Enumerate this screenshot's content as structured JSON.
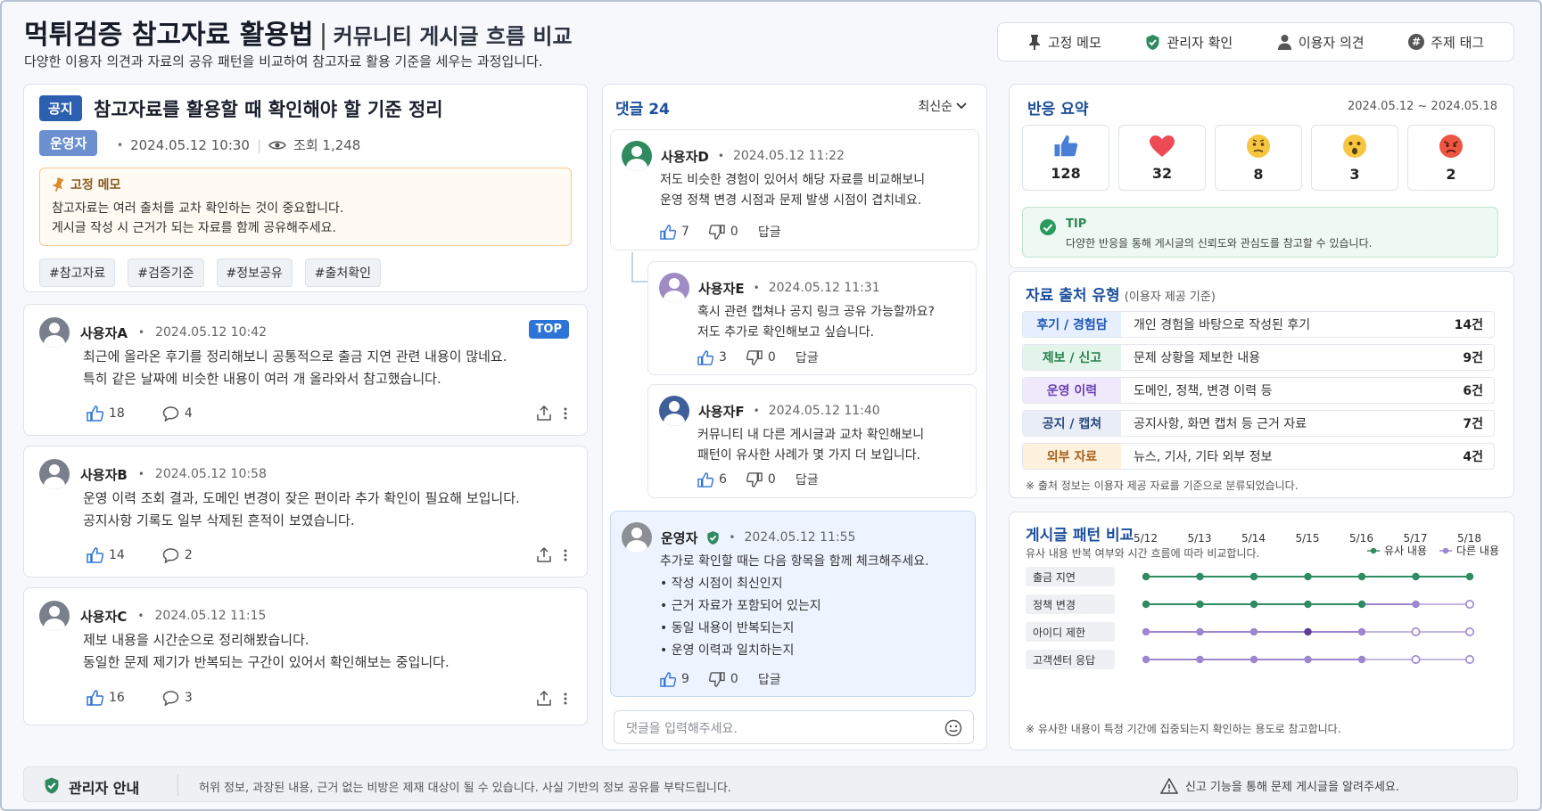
{
  "header": {
    "title": "먹튀검증 참고자료 활용법",
    "title_sep": "|",
    "subtitle": "커뮤니티 게시글 흐름 비교",
    "description": "다양한 이용자 의견과 자료의 공유 패턴을 비교하여 참고자료 활용 기준을 세우는 과정입니다.",
    "filters": [
      {
        "label": "고정 메모",
        "icon": "pin-icon"
      },
      {
        "label": "관리자 확인",
        "icon": "shield-icon"
      },
      {
        "label": "이용자 의견",
        "icon": "user-icon"
      },
      {
        "label": "주제 태그",
        "icon": "hash-icon"
      }
    ]
  },
  "notice": {
    "badge": "공지",
    "title": "참고자료를 활용할 때 확인해야 할 기준 정리",
    "author_badge": "운영자",
    "date": "2024.05.12 10:30",
    "views": "조회 1,248",
    "pin_title": "고정 메모",
    "pin_lines": [
      "참고자료는 여러 출처를 교차 확인하는 것이 중요합니다.",
      "게시글 작성 시 근거가 되는 자료를 함께 공유해주세요."
    ],
    "tags": [
      "#참고자료",
      "#검증기준",
      "#정보공유",
      "#출처확인"
    ]
  },
  "posts": [
    {
      "user": "사용자A",
      "time": "2024.05.12 10:42",
      "badge": "TOP",
      "lines": [
        "최근에 올라온 후기를 정리해보니 공통적으로 출금 지연 관련 내용이 많네요.",
        "특히 같은 날짜에 비슷한 내용이 여러 개 올라와서 참고했습니다."
      ],
      "likes": "18",
      "comments": "4"
    },
    {
      "user": "사용자B",
      "time": "2024.05.12 10:58",
      "lines": [
        "운영 이력 조회 결과, 도메인 변경이 잦은 편이라 추가 확인이 필요해 보입니다.",
        "공지사항 기록도 일부 삭제된 흔적이 보였습니다."
      ],
      "likes": "14",
      "comments": "2"
    },
    {
      "user": "사용자C",
      "time": "2024.05.12 11:15",
      "lines": [
        "제보 내용을 시간순으로 정리해봤습니다.",
        "동일한 문제 제기가 반복되는 구간이 있어서 확인해보는 중입니다."
      ],
      "likes": "16",
      "comments": "3"
    }
  ],
  "comments": {
    "title": "댓글 24",
    "sort": "최신순",
    "reply_label": "답글",
    "items": [
      {
        "user": "사용자D",
        "time": "2024.05.12 11:22",
        "lines": [
          "저도 비슷한 경험이 있어서 해당 자료를 비교해보니",
          "운영 정책 변경 시점과 문제 발생 시점이 겹치네요."
        ],
        "likes": "7",
        "dislikes": "0"
      },
      {
        "user": "사용자E",
        "time": "2024.05.12 11:31",
        "lines": [
          "혹시 관련 캡쳐나 공지 링크 공유 가능할까요?",
          "저도 추가로 확인해보고 싶습니다."
        ],
        "likes": "3",
        "dislikes": "0"
      },
      {
        "user": "사용자F",
        "time": "2024.05.12 11:40",
        "lines": [
          "커뮤니티 내 다른 게시글과 교차 확인해보니",
          "패턴이 유사한 사례가 몇 가지 더 보입니다."
        ],
        "likes": "6",
        "dislikes": "0"
      },
      {
        "user": "운영자",
        "time": "2024.05.12 11:55",
        "intro": "추가로 확인할 때는 다음 항목을 함께 체크해주세요.",
        "bullets": [
          "작성 시점이 최신인지",
          "근거 자료가 포함되어 있는지",
          "동일 내용이 반복되는지",
          "운영 이력과 일치하는지"
        ],
        "likes": "9",
        "dislikes": "0"
      }
    ],
    "input_placeholder": "댓글을 입력해주세요."
  },
  "reactions": {
    "title": "반응 요약",
    "range": "2024.05.12 ~ 2024.05.18",
    "items": [
      {
        "icon": "thumbs-up-icon",
        "count": "128"
      },
      {
        "icon": "heart-icon",
        "count": "32"
      },
      {
        "icon": "confused-face-icon",
        "count": "8"
      },
      {
        "icon": "surprised-face-icon",
        "count": "3"
      },
      {
        "icon": "angry-face-icon",
        "count": "2"
      }
    ],
    "tip_title": "TIP",
    "tip_text": "다양한 반응을 통해 게시글의 신뢰도와 관심도를 참고할 수 있습니다."
  },
  "sources": {
    "title": "자료 출처 유형",
    "subtitle": "(이용자 제공 기준)",
    "rows": [
      {
        "tag": "후기 / 경험담",
        "desc": "개인 경험을 바탕으로 작성된 후기",
        "count": "14건",
        "bg": "#e6efff",
        "fg": "#1e55b3"
      },
      {
        "tag": "제보 / 신고",
        "desc": "문제 상황을 제보한 내용",
        "count": "9건",
        "bg": "#e3f5ea",
        "fg": "#27824f"
      },
      {
        "tag": "운영 이력",
        "desc": "도메인, 정책, 변경 이력 등",
        "count": "6건",
        "bg": "#f0e9fb",
        "fg": "#6b3fb5"
      },
      {
        "tag": "공지 / 캡쳐",
        "desc": "공지사항, 화면 캡처 등 근거 자료",
        "count": "7건",
        "bg": "#e8edf7",
        "fg": "#2d4a80"
      },
      {
        "tag": "외부 자료",
        "desc": "뉴스, 기사, 기타 외부 정보",
        "count": "4건",
        "bg": "#fdf0dc",
        "fg": "#a8611a"
      }
    ],
    "note": "※ 출처 정보는 이용자 제공 자료를 기준으로 분류되었습니다."
  },
  "pattern": {
    "title": "게시글 패턴 비교",
    "subtitle": "유사 내용 반복 여부와 시간 흐름에 따라 비교합니다.",
    "legend": [
      {
        "label": "유사 내용",
        "color": "#2e8b62"
      },
      {
        "label": "다른 내용",
        "color": "#9b86cf"
      }
    ],
    "dates": [
      "5/12",
      "5/13",
      "5/14",
      "5/15",
      "5/16",
      "5/17",
      "5/18"
    ],
    "rows": [
      {
        "label": "출금 지연",
        "marks": [
          "similar",
          "similar",
          "similar",
          "similar",
          "similar",
          "similar",
          "similar"
        ]
      },
      {
        "label": "정책 변경",
        "marks": [
          "similar",
          "similar",
          "similar",
          "similar",
          "similar",
          "different",
          "different-open"
        ]
      },
      {
        "label": "아이디 제한",
        "marks": [
          "different",
          "different",
          "different",
          "different-dark",
          "different",
          "different-open",
          "different-open"
        ]
      },
      {
        "label": "고객센터 응답",
        "marks": [
          "different",
          "different",
          "different",
          "different",
          "different",
          "different-open",
          "different-open"
        ]
      }
    ],
    "note": "※ 유사한 내용이 특정 기간에 집중되는지 확인하는 용도로 참고합니다."
  },
  "footer": {
    "title": "관리자 안내",
    "message": "허위 정보, 과장된 내용, 근거 없는 비방은 제재 대상이 될 수 있습니다. 사실 기반의 정보 공유를 부탁드립니다.",
    "report": "신고 기능을 통해 문제 게시글을 알려주세요."
  },
  "colors": {
    "accent": "#1d4f9c",
    "notice_badge": "#2d5fb0",
    "similar": "#2e8b62",
    "different": "#9b86cf"
  }
}
